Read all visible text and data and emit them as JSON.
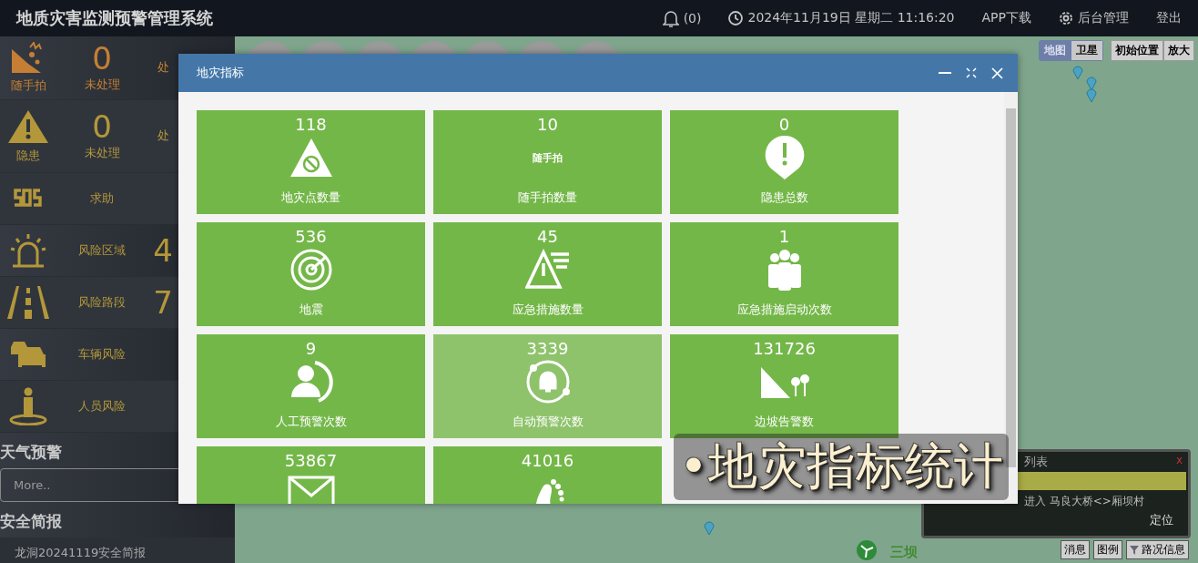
{
  "header": {
    "title": "地质灾害监测预警管理系统",
    "notifications": "(0)",
    "datetime": "2024年11月19日 星期二 11:16:20",
    "app_download": "APP下载",
    "admin": "后台管理",
    "logout": "登出"
  },
  "sidebar": {
    "items": [
      {
        "kind": "counter",
        "label": "随手拍",
        "value": "0",
        "status": "未处理",
        "extra": "处",
        "color": "#c47f34"
      },
      {
        "kind": "counter",
        "label": "隐患",
        "value": "0",
        "status": "未处理",
        "extra": "处",
        "color": "#b3973a"
      },
      {
        "kind": "link",
        "label": "求助",
        "color": "#b3973a"
      },
      {
        "kind": "link",
        "label": "风险区域",
        "extra": "4",
        "color": "#b3973a"
      },
      {
        "kind": "link",
        "label": "风险路段",
        "extra": "7",
        "color": "#b3973a"
      },
      {
        "kind": "link",
        "label": "车辆风险",
        "color": "#b3973a"
      },
      {
        "kind": "link",
        "label": "人员风险",
        "color": "#b3973a"
      }
    ],
    "weather": {
      "heading": "天气预警",
      "more": "More.."
    },
    "safety": {
      "heading": "安全简报",
      "item": "龙洞20241119安全简报"
    }
  },
  "map": {
    "types": [
      {
        "label": "地图",
        "selected": true
      },
      {
        "label": "卫星",
        "selected": false
      }
    ],
    "reset": "初始位置",
    "zoom_in": "放大",
    "place": "三坝",
    "panel": {
      "title": "列表",
      "close": "x",
      "row": "进入 马良大桥<>厢坝村",
      "locate": "定位"
    },
    "buttons": [
      "消息",
      "图例",
      "路况信息"
    ]
  },
  "modal": {
    "title": "地灾指标",
    "tiles": [
      {
        "name": "地灾点数量",
        "count": "118",
        "selected": false
      },
      {
        "name": "随手拍数量",
        "count": "10",
        "icon_text": "随手拍",
        "selected": false
      },
      {
        "name": "隐患总数",
        "count": "0",
        "selected": false
      },
      {
        "name": "地震",
        "count": "536",
        "selected": false
      },
      {
        "name": "应急措施数量",
        "count": "45",
        "selected": false
      },
      {
        "name": "应急措施启动次数",
        "count": "1",
        "selected": false
      },
      {
        "name": "人工预警次数",
        "count": "9",
        "selected": false
      },
      {
        "name": "自动预警次数",
        "count": "3339",
        "selected": true
      },
      {
        "name": "边坡告警数",
        "count": "131726",
        "selected": false
      },
      {
        "count": "53867",
        "selected": false
      },
      {
        "count": "41016",
        "selected": false
      }
    ]
  },
  "caption": "•地灾指标统计"
}
